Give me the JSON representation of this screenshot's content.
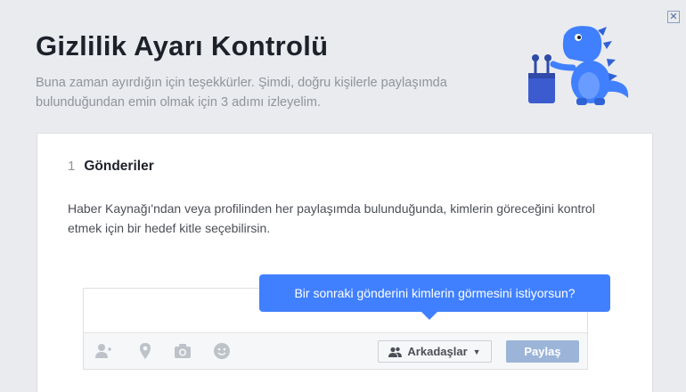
{
  "dialog": {
    "close_glyph": "✕",
    "title": "Gizlilik Ayarı Kontrolü",
    "subtitle": "Buna zaman ayırdığın için teşekkürler. Şimdi, doğru kişilerle paylaşımda bulunduğundan emin olmak için 3 adımı izleyelim."
  },
  "mascot": {
    "icon": "dinosaur-mascot",
    "color": "#4080ff"
  },
  "step": {
    "number": "1",
    "title": "Gönderiler",
    "description": "Haber Kaynağı'ndan veya profilinden her paylaşımda bulunduğunda, kimlerin göreceğini kontrol etmek için bir hedef kitle seçebilirsin."
  },
  "composer": {
    "tooltip": "Bir sonraki gönderini kimlerin görmesini istiyorsun?",
    "toolbar_icons": [
      "tag-friends-icon",
      "location-icon",
      "camera-icon",
      "feeling-icon"
    ],
    "audience_label": "Arkadaşlar",
    "share_label": "Paylaş"
  },
  "colors": {
    "background": "#e9ebee",
    "accent": "#4080ff",
    "share_button": "#9cb4d8",
    "title_text": "#1d2129",
    "muted_text": "#90949c"
  }
}
